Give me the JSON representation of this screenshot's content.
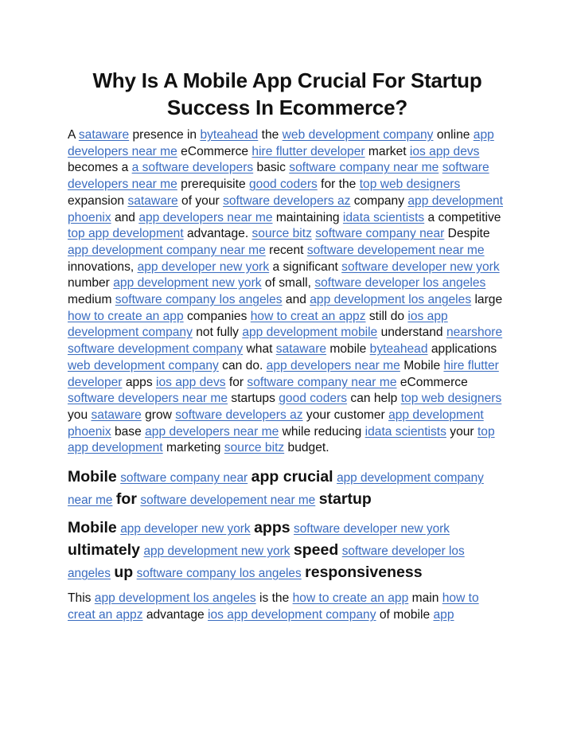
{
  "document": {
    "title": "Why Is A Mobile App Crucial For Startup Success In Ecommerce?",
    "link_color": "#3a6cc0",
    "blocks": [
      {
        "type": "paragraph",
        "runs": [
          {
            "t": "A "
          },
          {
            "l": "sataware"
          },
          {
            "t": " presence in "
          },
          {
            "l": "byteahead"
          },
          {
            "t": " the "
          },
          {
            "l": "web development company"
          },
          {
            "t": " online "
          },
          {
            "l": "app developers near me"
          },
          {
            "t": " eCommerce "
          },
          {
            "l": "hire flutter developer"
          },
          {
            "t": " market "
          },
          {
            "l": "ios app devs"
          },
          {
            "t": " becomes a "
          },
          {
            "l": "a software developers"
          },
          {
            "t": " basic "
          },
          {
            "l": "software company near me"
          },
          {
            "t": " "
          },
          {
            "l": "software developers near me"
          },
          {
            "t": " prerequisite "
          },
          {
            "l": "good coders"
          },
          {
            "t": " for the "
          },
          {
            "l": "top web designers"
          },
          {
            "t": " expansion "
          },
          {
            "l": "sataware"
          },
          {
            "t": " of your "
          },
          {
            "l": "software developers az"
          },
          {
            "t": " company "
          },
          {
            "l": "app development phoenix"
          },
          {
            "t": " and "
          },
          {
            "l": "app developers near me"
          },
          {
            "t": " maintaining "
          },
          {
            "l": "idata scientists"
          },
          {
            "t": " a competitive "
          },
          {
            "l": "top app development"
          },
          {
            "t": " advantage. "
          },
          {
            "l": "source bitz"
          },
          {
            "t": " "
          },
          {
            "l": "software company near"
          },
          {
            "t": " Despite "
          },
          {
            "l": "app development company near me"
          },
          {
            "t": " recent "
          },
          {
            "l": "software developement near me"
          },
          {
            "t": " innovations, "
          },
          {
            "l": "app developer new york"
          },
          {
            "t": " a significant "
          },
          {
            "l": "software developer new york"
          },
          {
            "t": " number "
          },
          {
            "l": "app development new york"
          },
          {
            "t": " of small, "
          },
          {
            "l": "software developer los angeles"
          },
          {
            "t": " medium "
          },
          {
            "l": "software company los angeles"
          },
          {
            "t": " and "
          },
          {
            "l": "app development los angeles"
          },
          {
            "t": " large "
          },
          {
            "l": "how to create an app"
          },
          {
            "t": " companies "
          },
          {
            "l": "how to creat an appz"
          },
          {
            "t": " still do "
          },
          {
            "l": "ios app development company"
          },
          {
            "t": " not fully "
          },
          {
            "l": "app development mobile"
          },
          {
            "t": " understand "
          },
          {
            "l": "nearshore software development company"
          },
          {
            "t": " what "
          },
          {
            "l": "sataware"
          },
          {
            "t": " mobile "
          },
          {
            "l": "byteahead"
          },
          {
            "t": " applications "
          },
          {
            "l": "web development company"
          },
          {
            "t": " can do. "
          },
          {
            "l": "app developers near me"
          },
          {
            "t": " Mobile "
          },
          {
            "l": "hire flutter developer"
          },
          {
            "t": " apps "
          },
          {
            "l": "ios app devs"
          },
          {
            "t": " for "
          },
          {
            "l": "software company near me"
          },
          {
            "t": " eCommerce "
          },
          {
            "l": "software developers near me"
          },
          {
            "t": " startups "
          },
          {
            "l": "good coders"
          },
          {
            "t": " can help "
          },
          {
            "l": "top web designers"
          },
          {
            "t": " you "
          },
          {
            "l": "sataware"
          },
          {
            "t": " grow "
          },
          {
            "l": "software developers az"
          },
          {
            "t": " your customer "
          },
          {
            "l": "app development phoenix"
          },
          {
            "t": " base "
          },
          {
            "l": "app developers near me"
          },
          {
            "t": " while reducing "
          },
          {
            "l": "idata scientists"
          },
          {
            "t": " your "
          },
          {
            "l": "top app development"
          },
          {
            "t": " marketing "
          },
          {
            "l": "source bitz"
          },
          {
            "t": " budget."
          }
        ]
      },
      {
        "type": "heading",
        "runs": [
          {
            "b": "Mobile"
          },
          {
            "t": " "
          },
          {
            "l": "software company near"
          },
          {
            "t": " "
          },
          {
            "b": "app crucial"
          },
          {
            "t": " "
          },
          {
            "l": "app development company near me"
          },
          {
            "t": " "
          },
          {
            "b": "for"
          },
          {
            "t": " "
          },
          {
            "l": "software developement near me"
          },
          {
            "t": " "
          },
          {
            "b": "startup"
          }
        ]
      },
      {
        "type": "heading",
        "runs": [
          {
            "b": "Mobile"
          },
          {
            "t": " "
          },
          {
            "l": "app developer new york"
          },
          {
            "t": " "
          },
          {
            "b": "apps"
          },
          {
            "t": " "
          },
          {
            "l": "software developer new york"
          },
          {
            "t": " "
          },
          {
            "b": "ultimately"
          },
          {
            "t": " "
          },
          {
            "l": "app development new york"
          },
          {
            "t": " "
          },
          {
            "b": "speed"
          },
          {
            "t": " "
          },
          {
            "l": "software developer los angeles"
          },
          {
            "t": " "
          },
          {
            "b": "up"
          },
          {
            "t": " "
          },
          {
            "l": "software company los angeles"
          },
          {
            "t": " "
          },
          {
            "b": "responsiveness"
          }
        ]
      },
      {
        "type": "paragraph",
        "runs": [
          {
            "t": "This "
          },
          {
            "l": "app development los angeles"
          },
          {
            "t": " is the "
          },
          {
            "l": "how to create an app"
          },
          {
            "t": " main "
          },
          {
            "l": "how to creat an appz"
          },
          {
            "t": " advantage "
          },
          {
            "l": "ios app development company"
          },
          {
            "t": " of mobile "
          },
          {
            "l": "app"
          }
        ]
      }
    ]
  }
}
